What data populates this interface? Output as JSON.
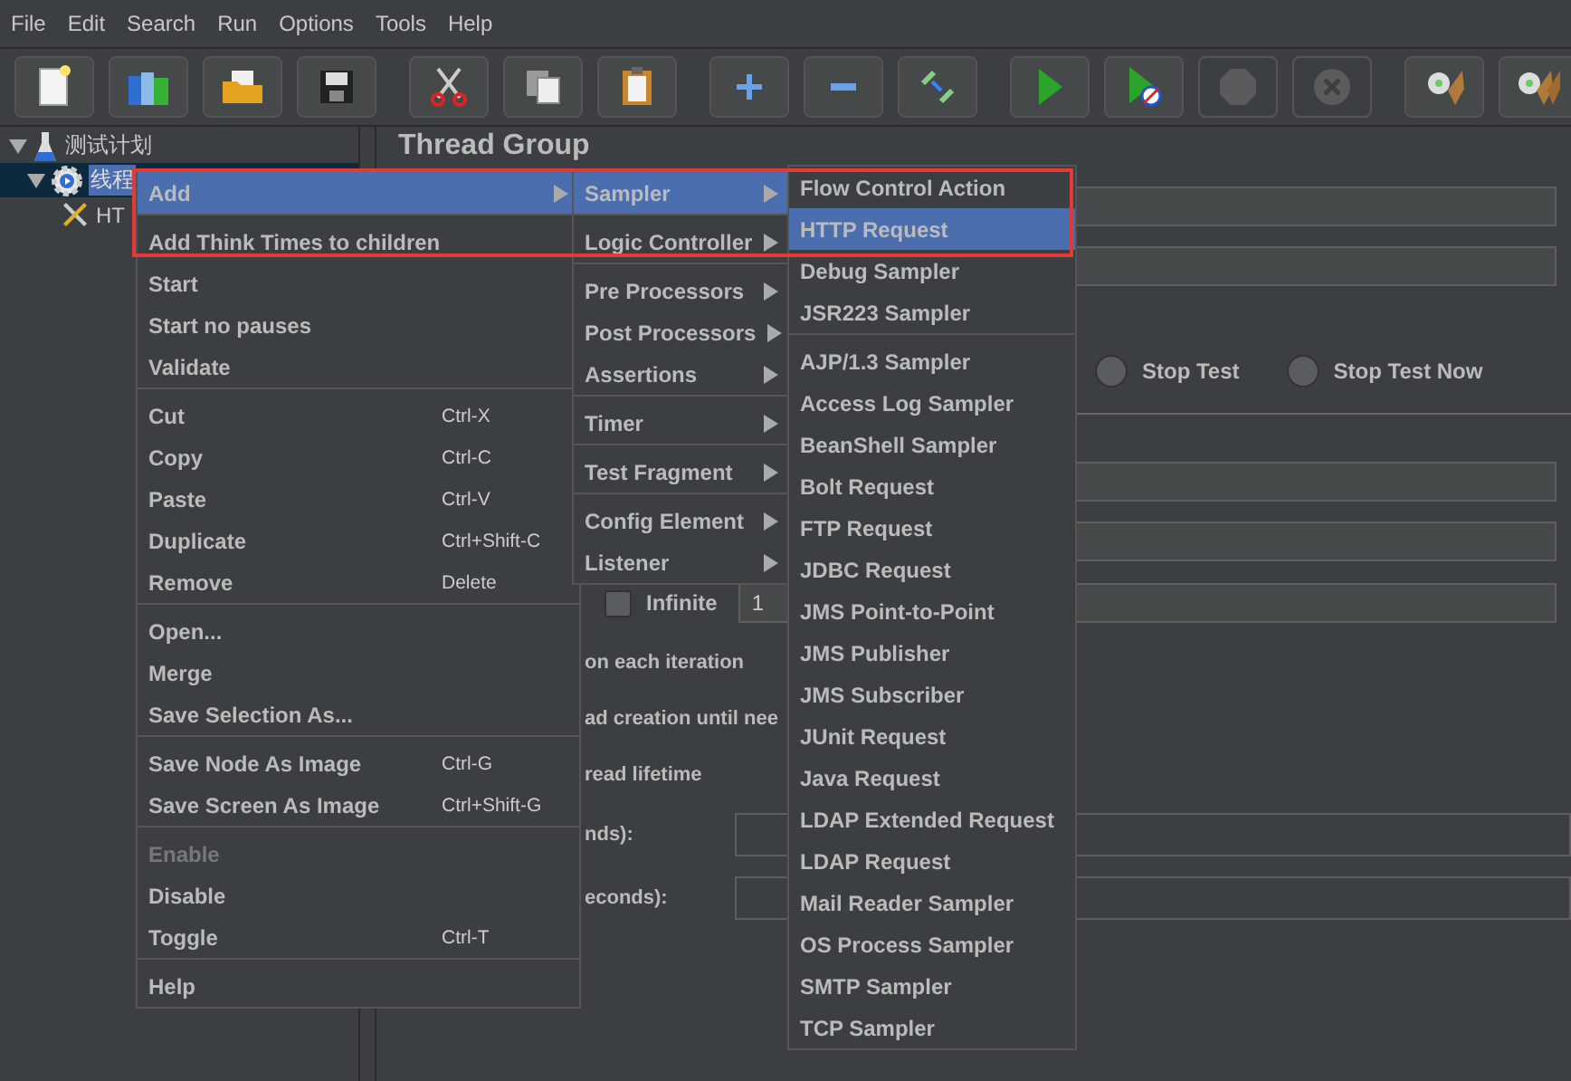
{
  "menu_bar": [
    {
      "label": "File"
    },
    {
      "label": "Edit"
    },
    {
      "label": "Search"
    },
    {
      "label": "Run"
    },
    {
      "label": "Options"
    },
    {
      "label": "Tools"
    },
    {
      "label": "Help"
    }
  ],
  "toolbar": [
    [
      {
        "kind": "new",
        "disabled": false
      },
      {
        "kind": "templates",
        "disabled": false
      },
      {
        "kind": "open",
        "disabled": false
      },
      {
        "kind": "save",
        "disabled": false
      }
    ],
    [
      {
        "kind": "cut",
        "disabled": false
      },
      {
        "kind": "copy",
        "disabled": false
      },
      {
        "kind": "paste",
        "disabled": false
      }
    ],
    [
      {
        "kind": "expand",
        "disabled": false
      },
      {
        "kind": "collapse",
        "disabled": false
      },
      {
        "kind": "toggle",
        "disabled": false
      }
    ],
    [
      {
        "kind": "start",
        "disabled": false
      },
      {
        "kind": "start-no-pause",
        "disabled": false
      },
      {
        "kind": "stop",
        "disabled": true
      },
      {
        "kind": "shutdown",
        "disabled": true
      }
    ],
    [
      {
        "kind": "clear",
        "disabled": false
      },
      {
        "kind": "clear-all",
        "disabled": false
      }
    ]
  ],
  "tree": [
    {
      "label": "测试计划",
      "kind": "plan",
      "expanded": true,
      "selected": false,
      "children": [
        {
          "label": "线程",
          "kind": "thread",
          "expanded": true,
          "selected": true,
          "children": [
            {
              "label": "HT",
              "kind": "sampler",
              "selected": false
            }
          ]
        }
      ]
    }
  ],
  "panel": {
    "title": "Thread Group",
    "radios": [
      {
        "label": "Stop Test",
        "selected": false
      },
      {
        "label": "Stop Test Now",
        "selected": false
      }
    ],
    "infinite": {
      "label": "Infinite",
      "checked": false
    },
    "loop_count": "1",
    "fragments": [
      {
        "kind": "text",
        "label": "on each iteration"
      },
      {
        "kind": "text",
        "label": "ad creation until nee"
      },
      {
        "kind": "text",
        "label": "read lifetime"
      },
      {
        "kind": "field",
        "label": "nds):"
      },
      {
        "kind": "field",
        "label": "econds):"
      }
    ]
  },
  "context_menu": [
    [
      {
        "label": "Add",
        "submenu": true,
        "selected": true,
        "disabled": false
      }
    ],
    [
      {
        "label": "Add Think Times to children",
        "submenu": false,
        "selected": false,
        "disabled": false
      },
      {
        "label": "Start",
        "submenu": false,
        "selected": false,
        "disabled": false
      },
      {
        "label": "Start no pauses",
        "submenu": false,
        "selected": false,
        "disabled": false
      },
      {
        "label": "Validate",
        "submenu": false,
        "selected": false,
        "disabled": false
      }
    ],
    [
      {
        "label": "Cut",
        "shortcut": "Ctrl-X",
        "submenu": false,
        "selected": false,
        "disabled": false
      },
      {
        "label": "Copy",
        "shortcut": "Ctrl-C",
        "submenu": false,
        "selected": false,
        "disabled": false
      },
      {
        "label": "Paste",
        "shortcut": "Ctrl-V",
        "submenu": false,
        "selected": false,
        "disabled": false
      },
      {
        "label": "Duplicate",
        "shortcut": "Ctrl+Shift-C",
        "submenu": false,
        "selected": false,
        "disabled": false
      },
      {
        "label": "Remove",
        "shortcut": "Delete",
        "submenu": false,
        "selected": false,
        "disabled": false
      }
    ],
    [
      {
        "label": "Open...",
        "submenu": false,
        "selected": false,
        "disabled": false
      },
      {
        "label": "Merge",
        "submenu": false,
        "selected": false,
        "disabled": false
      },
      {
        "label": "Save Selection As...",
        "submenu": false,
        "selected": false,
        "disabled": false
      }
    ],
    [
      {
        "label": "Save Node As Image",
        "shortcut": "Ctrl-G",
        "submenu": false,
        "selected": false,
        "disabled": false
      },
      {
        "label": "Save Screen As Image",
        "shortcut": "Ctrl+Shift-G",
        "submenu": false,
        "selected": false,
        "disabled": false
      }
    ],
    [
      {
        "label": "Enable",
        "submenu": false,
        "selected": false,
        "disabled": true
      },
      {
        "label": "Disable",
        "submenu": false,
        "selected": false,
        "disabled": false
      },
      {
        "label": "Toggle",
        "shortcut": "Ctrl-T",
        "submenu": false,
        "selected": false,
        "disabled": false
      }
    ],
    [
      {
        "label": "Help",
        "submenu": false,
        "selected": false,
        "disabled": false
      }
    ]
  ],
  "add_menu": [
    [
      {
        "label": "Sampler",
        "submenu": true,
        "selected": true,
        "disabled": false
      }
    ],
    [
      {
        "label": "Logic Controller",
        "submenu": true,
        "selected": false,
        "disabled": false
      }
    ],
    [
      {
        "label": "Pre Processors",
        "submenu": true,
        "selected": false,
        "disabled": false
      },
      {
        "label": "Post Processors",
        "submenu": true,
        "selected": false,
        "disabled": false
      },
      {
        "label": "Assertions",
        "submenu": true,
        "selected": false,
        "disabled": false
      }
    ],
    [
      {
        "label": "Timer",
        "submenu": true,
        "selected": false,
        "disabled": false
      }
    ],
    [
      {
        "label": "Test Fragment",
        "submenu": true,
        "selected": false,
        "disabled": false
      }
    ],
    [
      {
        "label": "Config Element",
        "submenu": true,
        "selected": false,
        "disabled": false
      },
      {
        "label": "Listener",
        "submenu": true,
        "selected": false,
        "disabled": false
      }
    ]
  ],
  "sampler_menu": [
    [
      {
        "label": "Flow Control Action",
        "submenu": false,
        "selected": false,
        "disabled": false
      },
      {
        "label": "HTTP Request",
        "submenu": false,
        "selected": true,
        "disabled": false
      },
      {
        "label": "Debug Sampler",
        "submenu": false,
        "selected": false,
        "disabled": false
      },
      {
        "label": "JSR223 Sampler",
        "submenu": false,
        "selected": false,
        "disabled": false
      }
    ],
    [
      {
        "label": "AJP/1.3 Sampler",
        "submenu": false,
        "selected": false,
        "disabled": false
      },
      {
        "label": "Access Log Sampler",
        "submenu": false,
        "selected": false,
        "disabled": false
      },
      {
        "label": "BeanShell Sampler",
        "submenu": false,
        "selected": false,
        "disabled": false
      },
      {
        "label": "Bolt Request",
        "submenu": false,
        "selected": false,
        "disabled": false
      },
      {
        "label": "FTP Request",
        "submenu": false,
        "selected": false,
        "disabled": false
      },
      {
        "label": "JDBC Request",
        "submenu": false,
        "selected": false,
        "disabled": false
      },
      {
        "label": "JMS Point-to-Point",
        "submenu": false,
        "selected": false,
        "disabled": false
      },
      {
        "label": "JMS Publisher",
        "submenu": false,
        "selected": false,
        "disabled": false
      },
      {
        "label": "JMS Subscriber",
        "submenu": false,
        "selected": false,
        "disabled": false
      },
      {
        "label": "JUnit Request",
        "submenu": false,
        "selected": false,
        "disabled": false
      },
      {
        "label": "Java Request",
        "submenu": false,
        "selected": false,
        "disabled": false
      },
      {
        "label": "LDAP Extended Request",
        "submenu": false,
        "selected": false,
        "disabled": false
      },
      {
        "label": "LDAP Request",
        "submenu": false,
        "selected": false,
        "disabled": false
      },
      {
        "label": "Mail Reader Sampler",
        "submenu": false,
        "selected": false,
        "disabled": false
      },
      {
        "label": "OS Process Sampler",
        "submenu": false,
        "selected": false,
        "disabled": false
      },
      {
        "label": "SMTP Sampler",
        "submenu": false,
        "selected": false,
        "disabled": false
      },
      {
        "label": "TCP Sampler",
        "submenu": false,
        "selected": false,
        "disabled": false
      }
    ]
  ]
}
